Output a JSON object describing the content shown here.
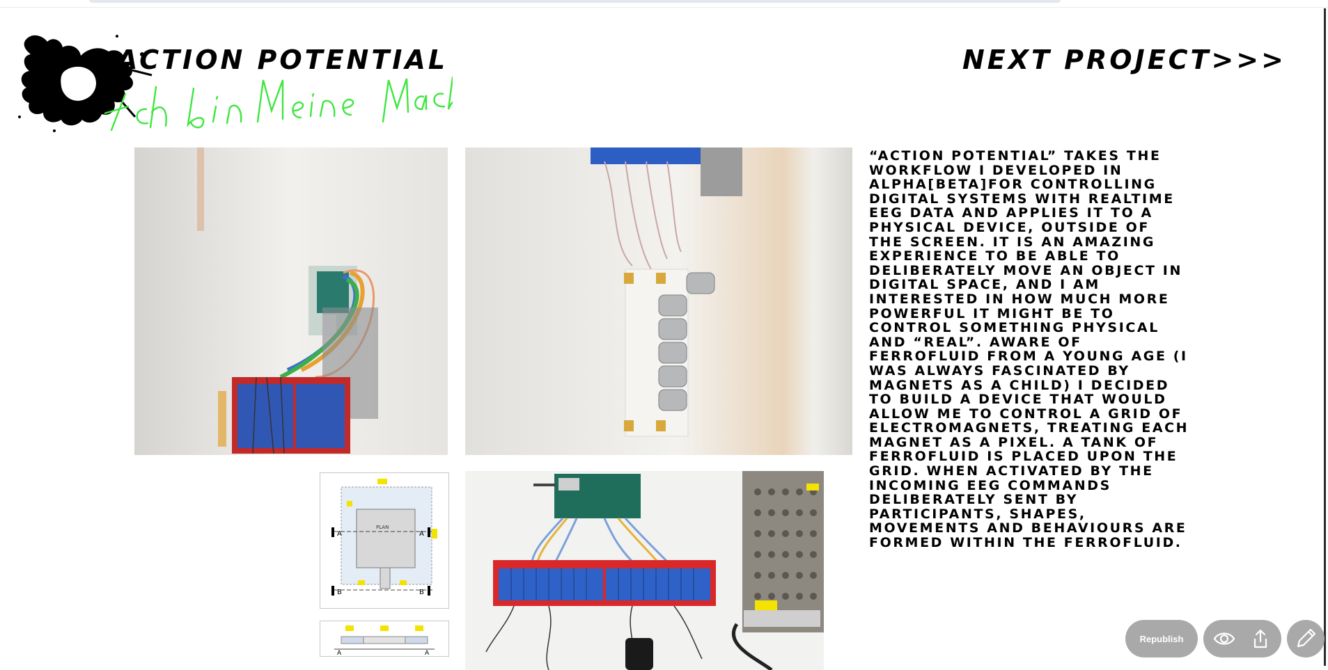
{
  "header": {
    "title": "ACTION POTENTIAL",
    "handwriting": "Ich bin Meine Machine",
    "next_project": "NEXT PROJECT>>>"
  },
  "images": [
    {
      "name": "relay-board-side-photo",
      "icon": "photo"
    },
    {
      "name": "electromagnet-grid-side-photo",
      "icon": "photo"
    },
    {
      "name": "plan-drawing",
      "icon": "technical-drawing",
      "labels": {
        "plan": "PLAN",
        "a": "A",
        "b": "B"
      }
    },
    {
      "name": "section-drawing",
      "icon": "technical-drawing",
      "labels": {
        "a": "A"
      }
    },
    {
      "name": "relay-board-top-photo",
      "icon": "photo"
    }
  ],
  "description": "“Action Potential” takes the workflow I developed in alpha[beta]for controlling digital systems with realtime EEG data and applies it to a physical device, outside of the screen. It is an amazing experience to be able to deliberately move an object in digital space, and I am interested in how much more powerful it might be to control something physical and “real”. Aware of ferrofluid from a young age (I was always fascinated by magnets as a child) I decided to build a device that would allow me to control a grid of electromagnets, treating each magnet as a pixel. A tank of ferrofluid is placed upon the grid. When activated by the incoming EEG commands deliberately sent by participants, shapes, movements and behaviours are formed within the ferrofluid.",
  "toolbar": {
    "republish_label": "Republish",
    "preview_icon": "eye-icon",
    "share_icon": "share-icon",
    "edit_icon": "pencil-icon"
  },
  "colors": {
    "button_bg": "#a9a9a9",
    "handwriting_green": "#3ee63e",
    "relay_blue": "#2f62c8",
    "board_red": "#d9282a"
  }
}
